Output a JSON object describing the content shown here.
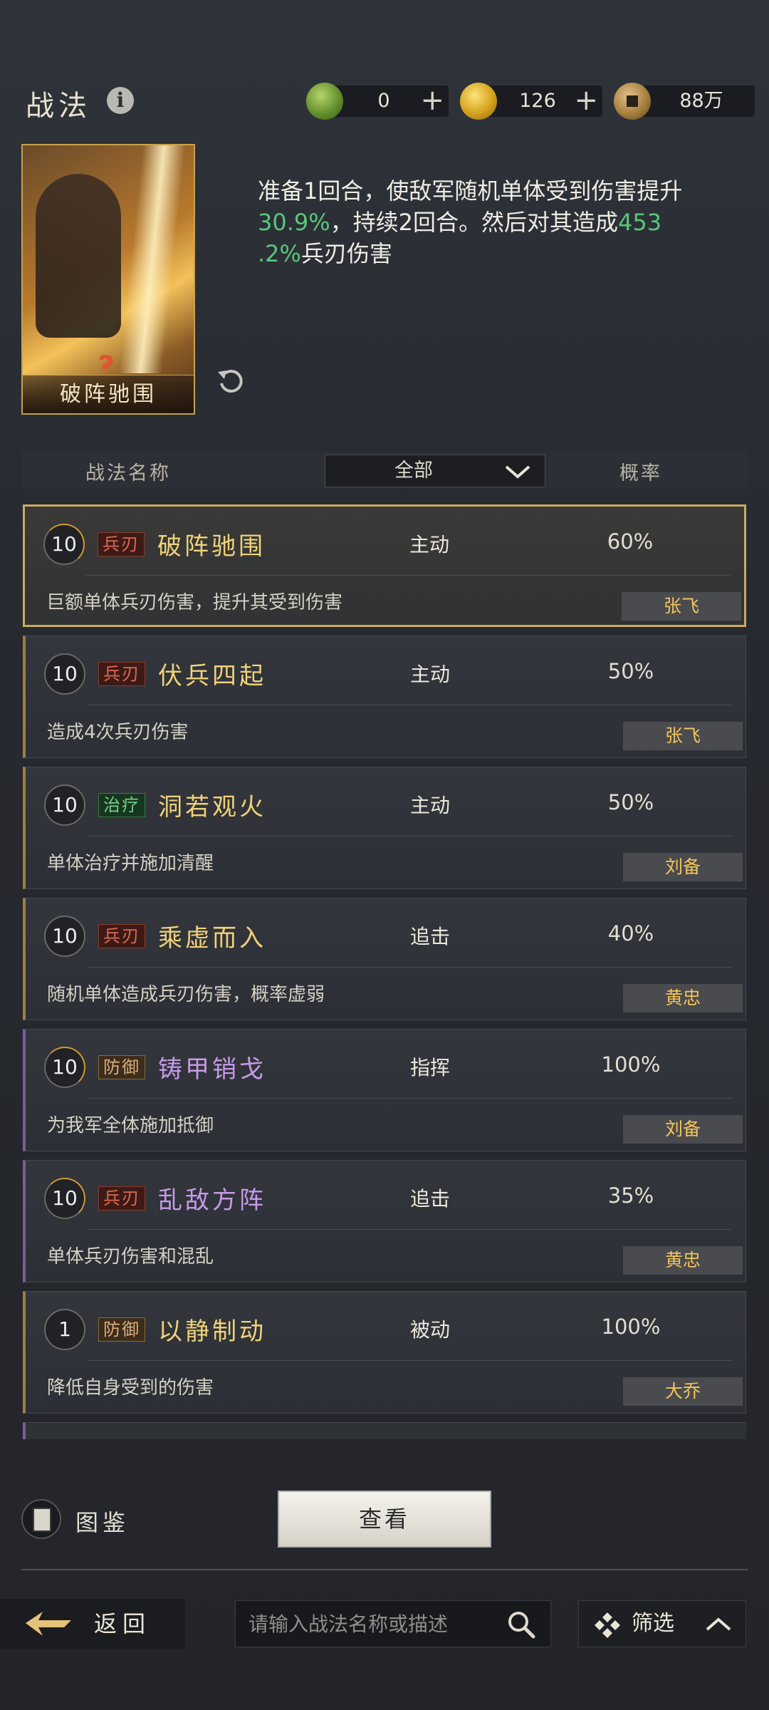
{
  "header": {
    "title": "战法",
    "currencies": [
      {
        "icon": "jade-coin-icon",
        "value": "0",
        "color": "#6c9a3a"
      },
      {
        "icon": "gold-coin-icon",
        "value": "126",
        "color": "#d4a21c"
      },
      {
        "icon": "copper-coin-icon",
        "value": "88万",
        "color": "#a8803e"
      }
    ]
  },
  "featured": {
    "card_name": "破阵驰围",
    "desc_1": "准备1回合，使敌军随机单体受到伤害提",
    "desc_2": "升",
    "desc_hl_1": "30.9%",
    "desc_3": "，持续2回合。然后对其造成",
    "desc_hl_2": "453",
    "desc_hl_3": ".2%",
    "desc_4": "兵刃伤害"
  },
  "table_header": {
    "name": "战法名称",
    "filter": "全部",
    "rate": "概率"
  },
  "skills": [
    {
      "level": "10",
      "tag": "兵刃",
      "name": "破阵驰围",
      "type": "主动",
      "rate": "60%",
      "desc": "巨额单体兵刃伤害，提升其受到伤害",
      "hero": "张飞"
    },
    {
      "level": "10",
      "tag": "兵刃",
      "name": "伏兵四起",
      "type": "主动",
      "rate": "50%",
      "desc": "造成4次兵刃伤害",
      "hero": "张飞"
    },
    {
      "level": "10",
      "tag": "治疗",
      "name": "洞若观火",
      "type": "主动",
      "rate": "50%",
      "desc": "单体治疗并施加清醒",
      "hero": "刘备"
    },
    {
      "level": "10",
      "tag": "兵刃",
      "name": "乘虚而入",
      "type": "追击",
      "rate": "40%",
      "desc": "随机单体造成兵刃伤害，概率虚弱",
      "hero": "黄忠"
    },
    {
      "level": "10",
      "tag": "防御",
      "name": "铸甲销戈",
      "type": "指挥",
      "rate": "100%",
      "desc": "为我军全体施加抵御",
      "hero": "刘备"
    },
    {
      "level": "10",
      "tag": "兵刃",
      "name": "乱敌方阵",
      "type": "追击",
      "rate": "35%",
      "desc": "单体兵刃伤害和混乱",
      "hero": "黄忠"
    },
    {
      "level": "1",
      "tag": "防御",
      "name": "以静制动",
      "type": "被动",
      "rate": "100%",
      "desc": "降低自身受到的伤害",
      "hero": "大乔"
    }
  ],
  "bottom": {
    "book_label": "图鉴",
    "view_button": "查看",
    "back_label": "返回",
    "search_placeholder": "请输入战法名称或描述",
    "filter_label": "筛选"
  }
}
